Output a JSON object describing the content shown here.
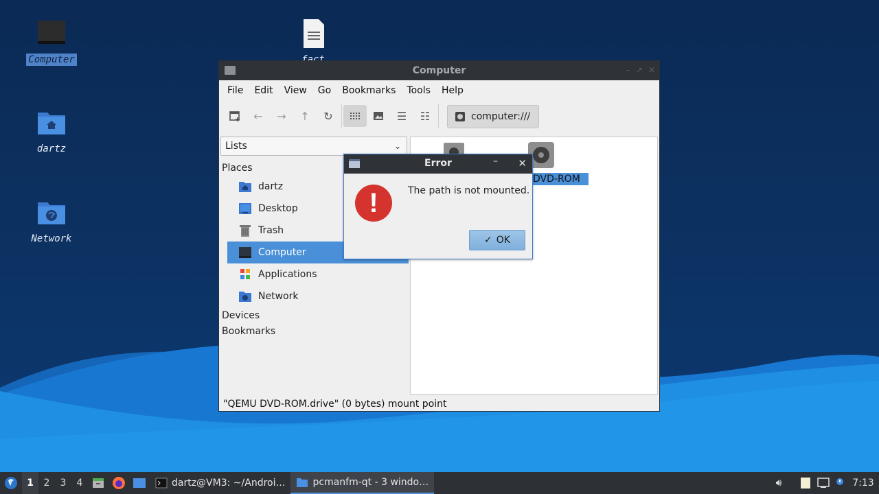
{
  "desktop": {
    "icons": [
      {
        "label": "Computer",
        "icon": "computer-icon"
      },
      {
        "label": "fact",
        "icon": "text-file-icon"
      },
      {
        "label": "dartz",
        "icon": "home-folder-icon"
      },
      {
        "label": "Network",
        "icon": "network-folder-icon"
      }
    ]
  },
  "window": {
    "title": "Computer",
    "menu": [
      "File",
      "Edit",
      "View",
      "Go",
      "Bookmarks",
      "Tools",
      "Help"
    ],
    "path": "computer:///",
    "sidebar_mode": "Lists",
    "places_header": "Places",
    "places": [
      {
        "label": "dartz",
        "icon": "home-folder-icon"
      },
      {
        "label": "Desktop",
        "icon": "desktop-icon"
      },
      {
        "label": "Trash",
        "icon": "trash-icon"
      },
      {
        "label": "Computer",
        "icon": "computer-icon"
      },
      {
        "label": "Applications",
        "icon": "applications-icon"
      },
      {
        "label": "Network",
        "icon": "network-icon"
      }
    ],
    "devices_header": "Devices",
    "bookmarks_header": "Bookmarks",
    "content_items": [
      {
        "label": "DVD-ROM",
        "icon": "optical-drive-icon"
      }
    ],
    "status": "\"QEMU DVD-ROM.drive\" (0 bytes) mount point"
  },
  "dialog": {
    "title": "Error",
    "message": "The path is not mounted.",
    "ok_label": "OK",
    "min_glyph": "–",
    "close_glyph": "✕"
  },
  "taskbar": {
    "workspaces": [
      "1",
      "2",
      "3",
      "4"
    ],
    "tasks": [
      {
        "label": "dartz@VM3: ~/Androi…",
        "icon": "terminal-icon"
      },
      {
        "label": "pcmanfm-qt - 3 windo…",
        "icon": "file-manager-icon"
      }
    ],
    "clock": "7:13"
  },
  "colors": {
    "accent": "#4a90d9",
    "error": "#d4342d",
    "panel": "#2d3034"
  }
}
